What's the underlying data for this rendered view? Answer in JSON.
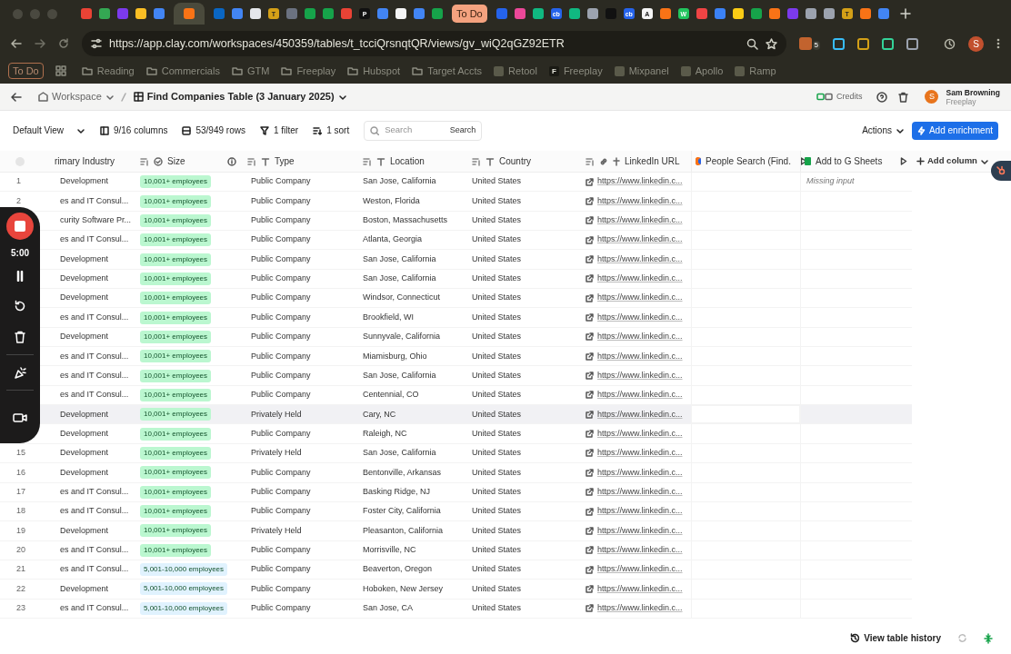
{
  "browser": {
    "tabs": [
      {
        "color": "#ea4335",
        "selected": false
      },
      {
        "color": "#34a853",
        "selected": false
      },
      {
        "color": "#7c3aed",
        "selected": false
      },
      {
        "color": "#fbbf24",
        "selected": false
      },
      {
        "color": "#4285f4",
        "selected": false
      },
      {
        "color": "#f97316",
        "selected": true
      },
      {
        "color": "#0a66c2",
        "selected": false
      },
      {
        "color": "#4285f4",
        "selected": false
      },
      {
        "color": "#e5e7eb",
        "selected": false
      },
      {
        "glyph": "T",
        "color": "#d4a017",
        "selected": false
      },
      {
        "color": "#6b7280",
        "selected": false
      },
      {
        "color": "#16a34a",
        "selected": false
      },
      {
        "color": "#16a34a",
        "selected": false
      },
      {
        "color": "#ea4335",
        "selected": false
      },
      {
        "glyph": "P",
        "color": "#111111",
        "selected": false
      },
      {
        "color": "#4285f4",
        "selected": false
      },
      {
        "color": "#f5f5f5",
        "selected": false
      },
      {
        "color": "#4285f4",
        "selected": false
      },
      {
        "color": "#16a34a",
        "selected": false
      },
      {
        "label": "To Do",
        "color": "#f4a27f",
        "selected": false
      },
      {
        "color": "#2563eb",
        "selected": false
      },
      {
        "color": "#ec4899",
        "selected": false
      },
      {
        "color": "#10b981",
        "selected": false
      },
      {
        "glyph": "cb",
        "color": "#2563eb",
        "selected": false
      },
      {
        "color": "#10b981",
        "selected": false
      },
      {
        "color": "#9ca3af",
        "selected": false
      },
      {
        "color": "#111111",
        "selected": false
      },
      {
        "glyph": "cb",
        "color": "#2563eb",
        "selected": false
      },
      {
        "glyph": "A",
        "color": "#f5f5f5",
        "selected": false
      },
      {
        "color": "#f97316",
        "selected": false
      },
      {
        "glyph": "W",
        "color": "#22c55e",
        "selected": false
      },
      {
        "color": "#ef4444",
        "selected": false
      },
      {
        "color": "#3b82f6",
        "selected": false
      },
      {
        "color": "#facc15",
        "selected": false
      },
      {
        "color": "#16a34a",
        "selected": false
      },
      {
        "color": "#f97316",
        "selected": false
      },
      {
        "color": "#7c3aed",
        "selected": false
      },
      {
        "color": "#9ca3af",
        "selected": false
      },
      {
        "color": "#9ca3af",
        "selected": false
      },
      {
        "glyph": "T",
        "color": "#d4a017",
        "selected": false
      },
      {
        "color": "#f97316",
        "selected": false
      },
      {
        "color": "#4285f4",
        "selected": false
      }
    ],
    "url": "https://app.clay.com/workspaces/450359/tables/t_tcciQrsnqtQR/views/gv_wiQ2qGZ92ETR",
    "extension_badge": "5",
    "profile_initial": "S",
    "bookmarks": [
      {
        "label": "To Do",
        "kind": "tag"
      },
      {
        "label": "Reading",
        "kind": "folder"
      },
      {
        "label": "Commercials",
        "kind": "folder"
      },
      {
        "label": "GTM",
        "kind": "folder"
      },
      {
        "label": "Freeplay",
        "kind": "folder"
      },
      {
        "label": "Hubspot",
        "kind": "folder"
      },
      {
        "label": "Target Accts",
        "kind": "folder"
      },
      {
        "label": "Retool",
        "kind": "site"
      },
      {
        "label": "Freeplay",
        "kind": "site",
        "glyph": "F"
      },
      {
        "label": "Mixpanel",
        "kind": "site"
      },
      {
        "label": "Apollo",
        "kind": "site"
      },
      {
        "label": "Ramp",
        "kind": "site"
      }
    ]
  },
  "breadcrumb": {
    "workspace": "Workspace",
    "table": "Find Companies Table (3 January 2025)"
  },
  "header": {
    "credits": "Credits",
    "user_initial": "S",
    "user_name": "Sam Browning",
    "user_org": "Freeplay"
  },
  "toolbar": {
    "view": "Default View",
    "columns": "9/16 columns",
    "rows": "53/949 rows",
    "filter": "1 filter",
    "sort": "1 sort",
    "search_placeholder": "Search",
    "search_button": "Search",
    "actions": "Actions",
    "add_enrichment": "Add enrichment"
  },
  "table": {
    "select_all": {
      "checked": false
    },
    "columns": [
      "rimary Industry",
      "Size",
      "Type",
      "Location",
      "Country",
      "LinkedIn URL",
      "People Search (Find.",
      "Add to G Sheets"
    ],
    "add_column": "Add column",
    "rows": [
      {
        "number": "1",
        "industry": "Development",
        "size": {
          "label": "10,001+ employees",
          "color": "#bbf7d0"
        },
        "type": "Public Company",
        "location": "San Jose, California",
        "country": "United States",
        "url": "https://www.linkedin.c...",
        "sheets": "Missing input",
        "selected": false
      },
      {
        "number": "2",
        "industry": "es and IT Consul...",
        "size": {
          "label": "10,001+ employees",
          "color": "#bbf7d0"
        },
        "type": "Public Company",
        "location": "Weston, Florida",
        "country": "United States",
        "url": "https://www.linkedin.c...",
        "selected": false
      },
      {
        "industry": "curity Software Pr...",
        "size": {
          "label": "10,001+ employees",
          "color": "#bbf7d0"
        },
        "type": "Public Company",
        "location": "Boston, Massachusetts",
        "country": "United States",
        "url": "https://www.linkedin.c...",
        "selected": false
      },
      {
        "industry": "es and IT Consul...",
        "size": {
          "label": "10,001+ employees",
          "color": "#bbf7d0"
        },
        "type": "Public Company",
        "location": "Atlanta, Georgia",
        "country": "United States",
        "url": "https://www.linkedin.c...",
        "selected": false
      },
      {
        "industry": "Development",
        "size": {
          "label": "10,001+ employees",
          "color": "#bbf7d0"
        },
        "type": "Public Company",
        "location": "San Jose, California",
        "country": "United States",
        "url": "https://www.linkedin.c...",
        "selected": false
      },
      {
        "industry": "Development",
        "size": {
          "label": "10,001+ employees",
          "color": "#bbf7d0"
        },
        "type": "Public Company",
        "location": "San Jose, California",
        "country": "United States",
        "url": "https://www.linkedin.c...",
        "selected": false
      },
      {
        "industry": "Development",
        "size": {
          "label": "10,001+ employees",
          "color": "#bbf7d0"
        },
        "type": "Public Company",
        "location": "Windsor, Connecticut",
        "country": "United States",
        "url": "https://www.linkedin.c...",
        "selected": false
      },
      {
        "industry": "es and IT Consul...",
        "size": {
          "label": "10,001+ employees",
          "color": "#bbf7d0"
        },
        "type": "Public Company",
        "location": "Brookfield, WI",
        "country": "United States",
        "url": "https://www.linkedin.c...",
        "selected": false
      },
      {
        "industry": "Development",
        "size": {
          "label": "10,001+ employees",
          "color": "#bbf7d0"
        },
        "type": "Public Company",
        "location": "Sunnyvale, California",
        "country": "United States",
        "url": "https://www.linkedin.c...",
        "selected": false
      },
      {
        "industry": "es and IT Consul...",
        "size": {
          "label": "10,001+ employees",
          "color": "#bbf7d0"
        },
        "type": "Public Company",
        "location": "Miamisburg, Ohio",
        "country": "United States",
        "url": "https://www.linkedin.c...",
        "selected": false
      },
      {
        "industry": "es and IT Consul...",
        "size": {
          "label": "10,001+ employees",
          "color": "#bbf7d0"
        },
        "type": "Public Company",
        "location": "San Jose, California",
        "country": "United States",
        "url": "https://www.linkedin.c...",
        "selected": false
      },
      {
        "industry": "es and IT Consul...",
        "size": {
          "label": "10,001+ employees",
          "color": "#bbf7d0"
        },
        "type": "Public Company",
        "location": "Centennial, CO",
        "country": "United States",
        "url": "https://www.linkedin.c...",
        "selected": false
      },
      {
        "industry": "Development",
        "size": {
          "label": "10,001+ employees",
          "color": "#bbf7d0"
        },
        "type": "Privately Held",
        "location": "Cary, NC",
        "country": "United States",
        "url": "https://www.linkedin.c...",
        "selected": true
      },
      {
        "industry": "Development",
        "size": {
          "label": "10,001+ employees",
          "color": "#bbf7d0"
        },
        "type": "Public Company",
        "location": "Raleigh, NC",
        "country": "United States",
        "url": "https://www.linkedin.c...",
        "selected": false
      },
      {
        "number": "15",
        "industry": "Development",
        "size": {
          "label": "10,001+ employees",
          "color": "#bbf7d0"
        },
        "type": "Privately Held",
        "location": "San Jose, California",
        "country": "United States",
        "url": "https://www.linkedin.c...",
        "selected": false
      },
      {
        "number": "16",
        "industry": "Development",
        "size": {
          "label": "10,001+ employees",
          "color": "#bbf7d0"
        },
        "type": "Public Company",
        "location": "Bentonville, Arkansas",
        "country": "United States",
        "url": "https://www.linkedin.c...",
        "selected": false
      },
      {
        "number": "17",
        "industry": "es and IT Consul...",
        "size": {
          "label": "10,001+ employees",
          "color": "#bbf7d0"
        },
        "type": "Public Company",
        "location": "Basking Ridge, NJ",
        "country": "United States",
        "url": "https://www.linkedin.c...",
        "selected": false
      },
      {
        "number": "18",
        "industry": "es and IT Consul...",
        "size": {
          "label": "10,001+ employees",
          "color": "#bbf7d0"
        },
        "type": "Public Company",
        "location": "Foster City, California",
        "country": "United States",
        "url": "https://www.linkedin.c...",
        "selected": false
      },
      {
        "number": "19",
        "industry": "Development",
        "size": {
          "label": "10,001+ employees",
          "color": "#bbf7d0"
        },
        "type": "Privately Held",
        "location": "Pleasanton, California",
        "country": "United States",
        "url": "https://www.linkedin.c...",
        "selected": false
      },
      {
        "number": "20",
        "industry": "es and IT Consul...",
        "size": {
          "label": "10,001+ employees",
          "color": "#bbf7d0"
        },
        "type": "Public Company",
        "location": "Morrisville, NC",
        "country": "United States",
        "url": "https://www.linkedin.c...",
        "selected": false
      },
      {
        "number": "21",
        "industry": "es and IT Consul...",
        "size": {
          "label": "5,001-10,000 employees",
          "color": "#e0f2fe"
        },
        "type": "Public Company",
        "location": "Beaverton, Oregon",
        "country": "United States",
        "url": "https://www.linkedin.c...",
        "selected": false
      },
      {
        "number": "22",
        "industry": "Development",
        "size": {
          "label": "5,001-10,000 employees",
          "color": "#e0f2fe"
        },
        "type": "Public Company",
        "location": "Hoboken, New Jersey",
        "country": "United States",
        "url": "https://www.linkedin.c...",
        "selected": false
      },
      {
        "number": "23",
        "industry": "es and IT Consul...",
        "size": {
          "label": "5,001-10,000 employees",
          "color": "#e0f2fe"
        },
        "type": "Public Company",
        "location": "San Jose, CA",
        "country": "United States",
        "url": "https://www.linkedin.c...",
        "selected": false
      }
    ]
  },
  "recorder": {
    "time": "5:00"
  },
  "footer": {
    "history": "View table history"
  }
}
